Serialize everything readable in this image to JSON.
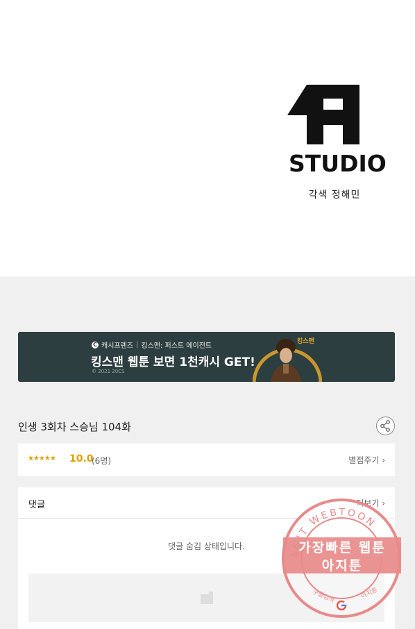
{
  "artwork": {
    "logo_text": "STUDIO",
    "credit": "각색 정해민"
  },
  "banner": {
    "brand": "캐시프렌즈",
    "sponsor": "킹스맨: 퍼스트 에이전트",
    "headline": "킹스맨 웹툰 보면 1천캐시 GET!",
    "copyright": "© 2021 20CS",
    "tag": "킹스맨"
  },
  "episode": {
    "title": "인생 3회차 스승님 104화"
  },
  "rating": {
    "stars": "★★★★★",
    "score": "10.0",
    "votes": "(6명)",
    "rate_label": "별점주기 ›"
  },
  "comments": {
    "label": "댓글",
    "more_label": "더보기 ›",
    "hidden_notice": "댓글 숨김 상태입니다."
  },
  "watermark": {
    "ring_text": "AGIT WEBTOON",
    "line1": "가장빠른 웹툰",
    "line2": "아지툰",
    "bottom_left": "구글검색",
    "bottom_right": "아지툰"
  },
  "colors": {
    "star": "#e0a100",
    "banner_bg": "#2c3e3f",
    "stamp": "#e88a8a"
  }
}
